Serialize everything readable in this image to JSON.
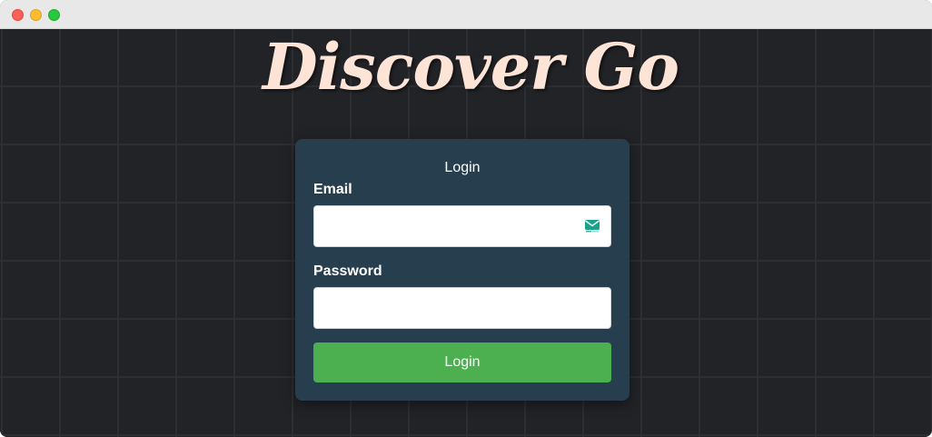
{
  "brand": {
    "title": "Discover Go"
  },
  "login_form": {
    "heading": "Login",
    "email": {
      "label": "Email",
      "value": "",
      "placeholder": ""
    },
    "password": {
      "label": "Password",
      "value": "",
      "placeholder": ""
    },
    "submit_label": "Login"
  },
  "icons": {
    "email_field_icon": "mail-icon"
  },
  "colors": {
    "background": "#222327",
    "card": "#263e4e",
    "button": "#4caf50",
    "brand_text": "#fde4d6",
    "mail_icon": "#1aa38a"
  }
}
